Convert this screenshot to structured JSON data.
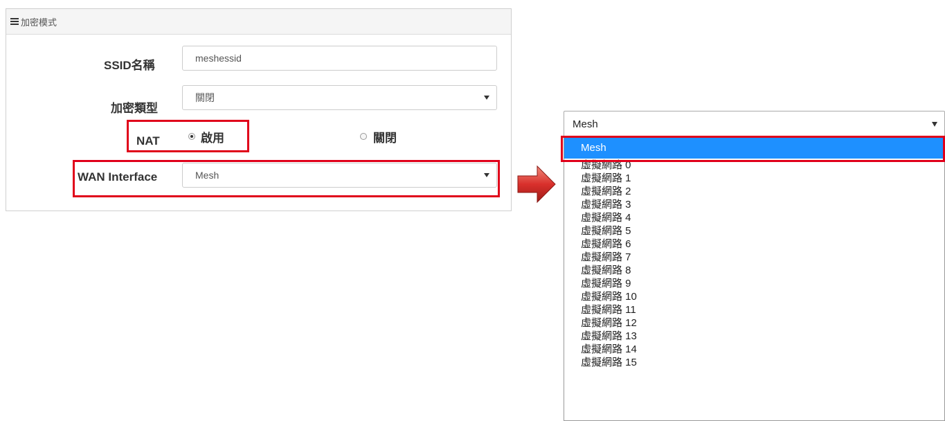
{
  "panel": {
    "title": "加密模式",
    "ssid_label": "SSID名稱",
    "ssid_value": "meshessid",
    "enc_label": "加密類型",
    "enc_value": "關閉",
    "nat_label": "NAT",
    "nat_on_label": "啟用",
    "nat_off_label": "關閉",
    "nat_selected": "啟用",
    "wan_label": "WAN Interface",
    "wan_value": "Mesh"
  },
  "dropdown": {
    "current": "Mesh",
    "options": [
      "Mesh",
      "虛擬網路 0",
      "虛擬網路 1",
      "虛擬網路 2",
      "虛擬網路 3",
      "虛擬網路 4",
      "虛擬網路 5",
      "虛擬網路 6",
      "虛擬網路 7",
      "虛擬網路 8",
      "虛擬網路 9",
      "虛擬網路 10",
      "虛擬網路 11",
      "虛擬網路 12",
      "虛擬網路 13",
      "虛擬網路 14",
      "虛擬網路 15"
    ],
    "selected_index": 0
  },
  "colors": {
    "highlight": "#e0001a",
    "selected_option": "#1e90ff",
    "arrow": "#d9302c"
  }
}
